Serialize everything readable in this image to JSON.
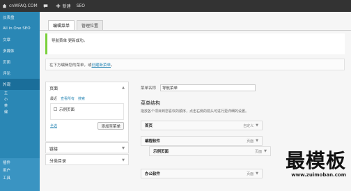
{
  "adminbar": {
    "site": "cnWFAQ.COM",
    "new_label": "新建",
    "seo_label": "SEO"
  },
  "sidebar": {
    "items": [
      {
        "label": "仪表盘"
      },
      {
        "label": "All in One SEO"
      },
      {
        "label": "文章"
      },
      {
        "label": "多媒体"
      },
      {
        "label": "页面"
      },
      {
        "label": "评论"
      },
      {
        "label": "外观"
      },
      {
        "label": "主"
      },
      {
        "label": "小"
      },
      {
        "label": "菜"
      },
      {
        "label": "编"
      }
    ],
    "tail_items": [
      {
        "label": "插件"
      },
      {
        "label": "用户"
      },
      {
        "label": "工具"
      }
    ]
  },
  "tabs": [
    {
      "label": "编辑菜单"
    },
    {
      "label": "管理位置"
    }
  ],
  "notice": {
    "title": "导航菜单",
    "message": "更新成功。"
  },
  "instruction": {
    "text": "在下方编辑您的菜单，或",
    "link": "创建新菜单",
    "suffix": "。"
  },
  "left_panels": {
    "pages": {
      "title": "页面",
      "subtabs": [
        "最近",
        "查看所有",
        "搜索"
      ],
      "items": [
        "示例页面"
      ],
      "select_all": "全选",
      "add_button": "添加至菜单"
    },
    "links": {
      "title": "链接"
    },
    "categories": {
      "title": "分类目录"
    }
  },
  "menu": {
    "name_label": "菜单名称",
    "name_value": "导航菜单",
    "structure_title": "菜单结构",
    "structure_desc": "拖放各个项目到您喜欢的顺序，点击右侧的箭头可进行更详细的设置。",
    "items": [
      {
        "title": "首页",
        "type": "自定义"
      },
      {
        "title": "编程软件",
        "type": "页面"
      },
      {
        "title": "示例页面",
        "type": "页面"
      },
      {
        "title": "办公软件",
        "type": "页面"
      }
    ]
  },
  "watermark": {
    "text": "最模板",
    "url": "www.zuimoban.com"
  },
  "colors": {
    "sidebar": "#2a87b5",
    "adminbar": "#333333",
    "notice_border": "#7ad03a",
    "link": "#2a87b5"
  },
  "icons": {
    "home": "home-icon",
    "comment": "comment-icon",
    "plus": "plus-icon",
    "arrow": "triangle-down-icon"
  }
}
